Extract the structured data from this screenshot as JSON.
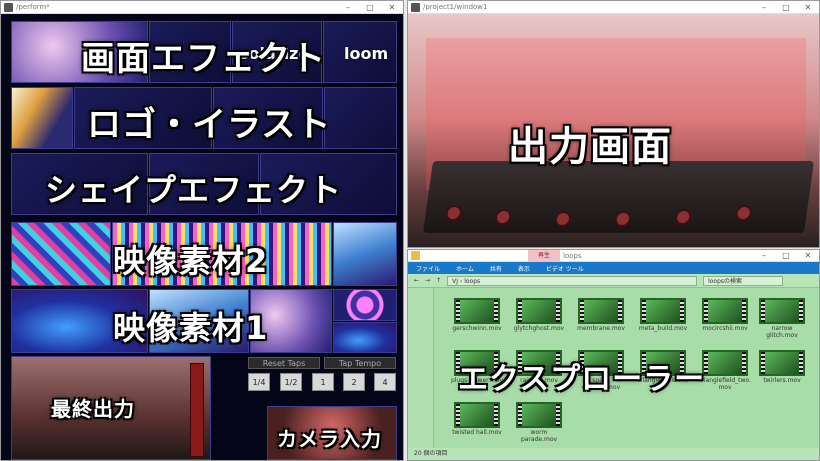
{
  "windows": {
    "perform": {
      "title": "/perform*",
      "controls": [
        "–",
        "□",
        "✕"
      ]
    },
    "output": {
      "title": "/project1/window1",
      "controls": [
        "–",
        "□",
        "✕"
      ]
    },
    "explorer": {
      "title": "loops",
      "controls": [
        "–",
        "□",
        "✕"
      ]
    }
  },
  "perform": {
    "rows": [
      {
        "label": "画面エフェクト",
        "tile_texts": [
          "solarize",
          "loom"
        ]
      },
      {
        "label": "ロゴ・イラスト"
      },
      {
        "label": "シェイプエフェクト"
      },
      {
        "label": "映像素材2"
      },
      {
        "label": "映像素材1"
      }
    ],
    "final_output_label": "最終出力",
    "camera_label": "カメラ入力",
    "reset_taps": "Reset Taps",
    "tap_tempo": "Tap Tempo",
    "tempo_buttons": [
      "1/4",
      "1/2",
      "1",
      "2",
      "4"
    ]
  },
  "output": {
    "overlay_label": "出力画面"
  },
  "explorer": {
    "play_tag": "再生",
    "ribbon_tabs": [
      "ファイル",
      "ホーム",
      "共有",
      "表示",
      "ビデオ ツール"
    ],
    "path": [
      "VJ",
      "loops"
    ],
    "search_placeholder": "loopsの検索",
    "overlay_label": "エクスプローラー",
    "files": [
      "gerschwinn.mov",
      "glytchghost.mov",
      "membrane.mov",
      "meta_build.mov",
      "mocircshii.mov",
      "narrow\nglitch.mov",
      "plugs slower.mov",
      "rainbee.mov",
      "space\ncrystals.mov",
      "triangle_field.mo\nv",
      "trianglefield_two.\nmov",
      "twirlers.mov",
      "twisted hall.mov",
      "worm\nparade.mov"
    ],
    "status": "20 個の項目"
  }
}
